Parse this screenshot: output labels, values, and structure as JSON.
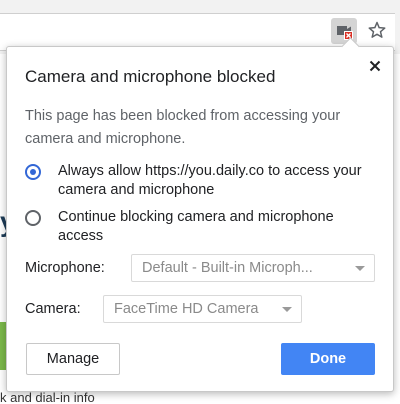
{
  "popup": {
    "title": "Camera and microphone blocked",
    "description": "This page has been blocked from accessing your camera and microphone.",
    "options": [
      {
        "label": "Always allow https://you.daily.co to access your camera and microphone",
        "selected": true
      },
      {
        "label": "Continue blocking camera and microphone access",
        "selected": false
      }
    ],
    "microphone": {
      "label": "Microphone:",
      "value": "Default - Built-in Microph..."
    },
    "camera": {
      "label": "Camera:",
      "value": "FaceTime HD Camera"
    },
    "buttons": {
      "manage": "Manage",
      "done": "Done"
    }
  },
  "background_page": {
    "footer_text": "k and dial-in info"
  },
  "colors": {
    "accent": "#4285f4",
    "radio_selected": "#3367d6",
    "blocked_badge": "#d93025"
  }
}
